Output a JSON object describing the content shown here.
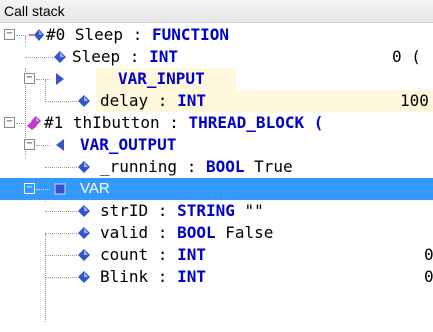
{
  "panel": {
    "title": "Call stack"
  },
  "rows": [
    {
      "name": "#0 Sleep",
      "sep": " : ",
      "type": "FUNCTION",
      "value": ""
    },
    {
      "name": "Sleep",
      "sep": " : ",
      "type": "INT",
      "value": "0 ("
    },
    {
      "name": "",
      "sep": "",
      "type": "VAR_INPUT",
      "value": ""
    },
    {
      "name": "delay",
      "sep": " : ",
      "type": "INT",
      "value": "100"
    },
    {
      "name": "#1 thIbutton",
      "sep": " : ",
      "type": "THREAD_BLOCK (",
      "value": ""
    },
    {
      "name": "",
      "sep": "",
      "type": "VAR_OUTPUT",
      "value": ""
    },
    {
      "name": "_running",
      "sep": " : ",
      "type": "BOOL",
      "value": "True"
    },
    {
      "name": "VAR",
      "sep": "",
      "type": "",
      "value": ""
    },
    {
      "name": "strID",
      "sep": " : ",
      "type": "STRING",
      "value": "\"\""
    },
    {
      "name": "valid",
      "sep": " : ",
      "type": "BOOL",
      "value": "False"
    },
    {
      "name": "count",
      "sep": " : ",
      "type": "INT",
      "value": "0"
    },
    {
      "name": "Blink",
      "sep": " : ",
      "type": "INT",
      "value": "0"
    }
  ],
  "colors": {
    "keyword": "#0000cc",
    "selection": "#3399ff",
    "var_icon": "#3355cc",
    "thread_icon": "#cc33cc"
  }
}
